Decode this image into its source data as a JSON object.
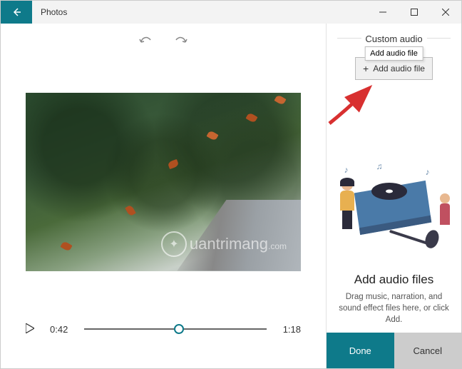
{
  "titlebar": {
    "app_name": "Photos"
  },
  "player": {
    "current_time": "0:42",
    "total_time": "1:18",
    "progress_percent": 52
  },
  "right": {
    "section_title": "Custom audio",
    "tooltip": "Add audio file",
    "add_button_label": "Add audio file",
    "empty_heading": "Add audio files",
    "empty_sub": "Drag music, narration, and sound effect files here, or click Add.",
    "done_label": "Done",
    "cancel_label": "Cancel"
  },
  "watermark": {
    "text": "uantrimang",
    "sub": ".com"
  },
  "colors": {
    "accent": "#0e7a8a"
  }
}
